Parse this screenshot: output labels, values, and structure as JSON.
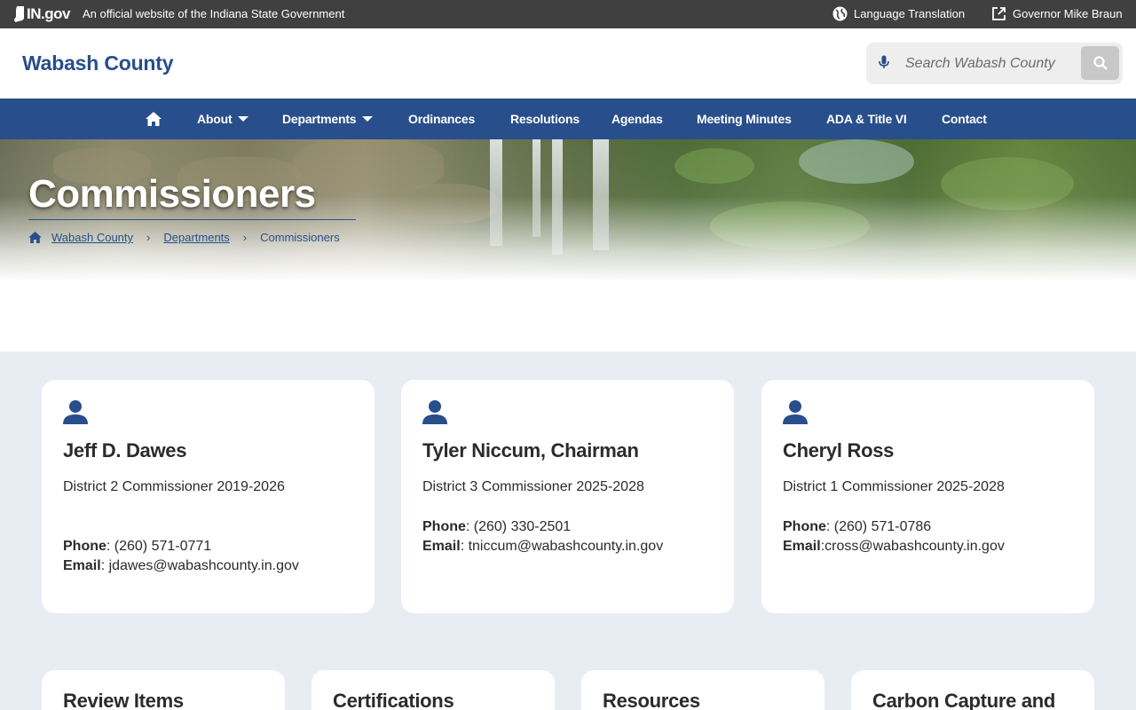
{
  "statebar": {
    "logo_text": "IN.gov",
    "official_text": "An official website of the Indiana State Government",
    "translate_label": "Language Translation",
    "governor_label": "Governor Mike Braun"
  },
  "header": {
    "site_title": "Wabash County",
    "search_placeholder": "Search Wabash County"
  },
  "nav": {
    "items": [
      {
        "label": "About",
        "dropdown": true
      },
      {
        "label": "Departments",
        "dropdown": true
      },
      {
        "label": "Ordinances"
      },
      {
        "label": "Resolutions"
      },
      {
        "label": "Agendas"
      },
      {
        "label": "Meeting Minutes"
      },
      {
        "label": "ADA & Title VI"
      },
      {
        "label": "Contact"
      }
    ]
  },
  "hero": {
    "title": "Commissioners",
    "breadcrumb": [
      "Wabash County",
      "Departments",
      "Commissioners"
    ]
  },
  "commissioners": [
    {
      "name": "Jeff D. Dawes",
      "role": "District 2 Commissioner 2019-2026",
      "phone_label": "Phone",
      "phone": ": (260) 571-0771",
      "email_label": "Email",
      "email": ": jdawes@wabashcounty.in.gov"
    },
    {
      "name": "Tyler Niccum, Chairman",
      "role": "District 3 Commissioner 2025-2028",
      "phone_label": "Phone",
      "phone": ": (260) 330-2501",
      "email_label": "Email",
      "email": ": tniccum@wabashcounty.in.gov"
    },
    {
      "name": "Cheryl Ross",
      "role": "District 1 Commissioner 2025-2028",
      "phone_label": "Phone",
      "phone": ": (260) 571-0786",
      "email_label": "Email",
      "email": ":cross@wabashcounty.in.gov"
    }
  ],
  "resource_cards": [
    {
      "title": "Review Items"
    },
    {
      "title": "Certifications"
    },
    {
      "title": "Resources"
    },
    {
      "title": "Carbon Capture and"
    }
  ],
  "colors": {
    "brand_blue": "#284e8b",
    "state_bar": "#404040",
    "band_background": "#e8ecf3"
  },
  "icons": [
    "indiana-logo-icon",
    "globe-icon",
    "external-link-icon",
    "microphone-icon",
    "search-icon",
    "home-icon",
    "chevron-right-icon",
    "person-icon"
  ]
}
